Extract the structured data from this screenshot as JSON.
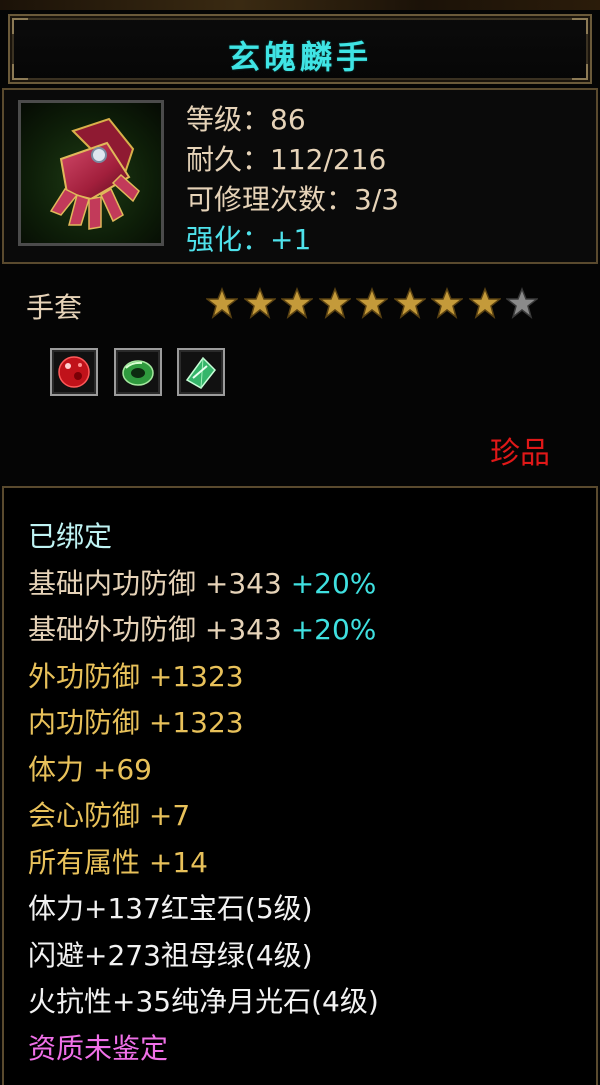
{
  "item": {
    "name": "玄魄麟手",
    "icon": "red-gauntlet-icon",
    "stats": [
      {
        "label": "等级：86",
        "color": "normal"
      },
      {
        "label": "耐久：112/216",
        "color": "normal"
      },
      {
        "label": "可修理次数：3/3",
        "color": "normal"
      },
      {
        "label": "强化：+1",
        "color": "cyan"
      }
    ],
    "type": "手套",
    "stars": {
      "filled": 8,
      "total": 9
    },
    "gems": [
      {
        "icon": "ruby-gem-icon"
      },
      {
        "icon": "emerald-ring-gem-icon"
      },
      {
        "icon": "green-crystal-gem-icon"
      }
    ],
    "rarity": "珍品"
  },
  "attributes": {
    "bound": "已绑定",
    "base": [
      {
        "text": "基础内功防御 +343 ",
        "pct": "+20%"
      },
      {
        "text": "基础外功防御 +343 ",
        "pct": "+20%"
      }
    ],
    "bonus": [
      "外功防御 +1323",
      "内功防御 +1323",
      "体力 +69",
      "会心防御 +7",
      "所有属性 +14"
    ],
    "gem_effects": [
      "体力+137红宝石(5级)",
      "闪避+273祖母绿(4级)",
      "火抗性+35纯净月光石(4级)"
    ],
    "quality": "资质未鉴定"
  },
  "colors": {
    "title": "#3fe4e4",
    "rarity": "#e01818",
    "enhance": "#4fe3ec",
    "bonus": "#e8c15a",
    "quality": "#f070e8"
  }
}
